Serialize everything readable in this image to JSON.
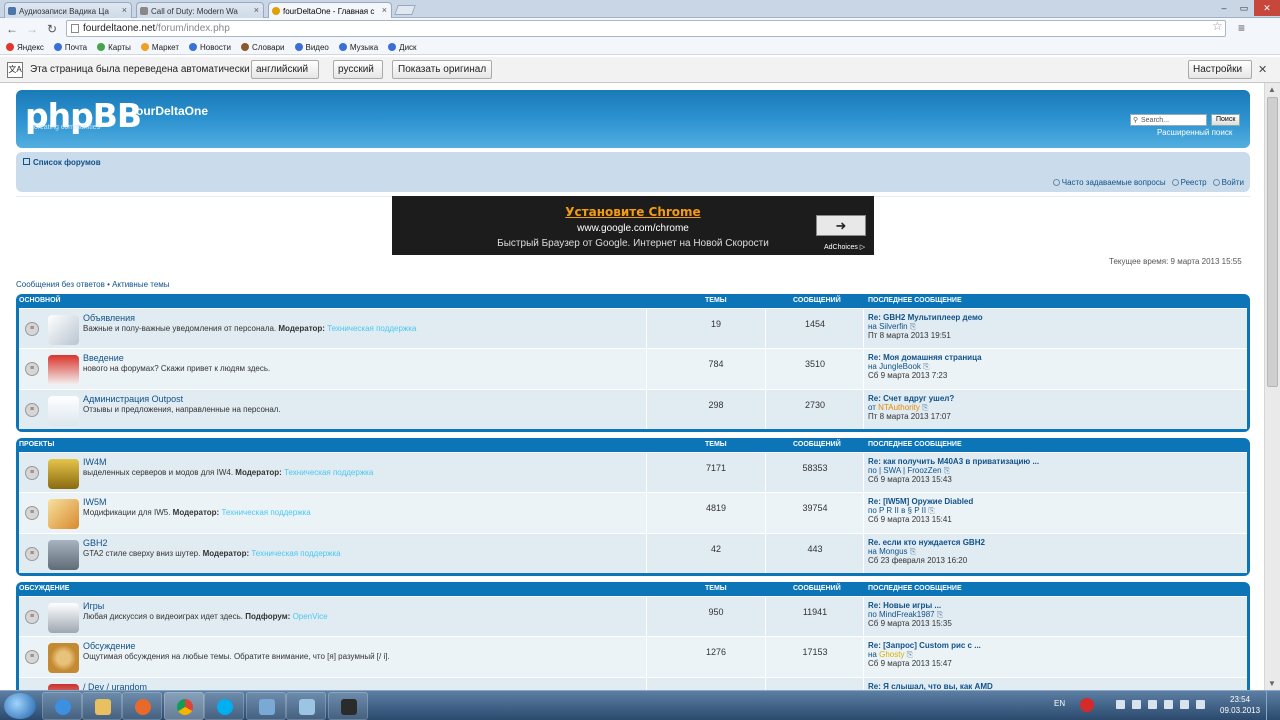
{
  "browser": {
    "tabs": [
      {
        "label": "Аудиозаписи Вадика Ца",
        "icon": "vk-icon",
        "color": "#4a76a8",
        "active": false
      },
      {
        "label": "Call of Duty: Modern Wa",
        "icon": "page-icon",
        "color": "#888888",
        "active": false
      },
      {
        "label": "fourDeltaOne - Главная с",
        "icon": "loading-icon",
        "color": "#e0a000",
        "active": true
      }
    ],
    "url_domain": "fourdeltaone.net",
    "url_path": "/forum/index.php",
    "bookmarks": [
      {
        "label": "Яндекс",
        "color": "#e0392b"
      },
      {
        "label": "Почта",
        "color": "#3a6fd8"
      },
      {
        "label": "Карты",
        "color": "#47a347"
      },
      {
        "label": "Маркет",
        "color": "#f0a020"
      },
      {
        "label": "Новости",
        "color": "#3a6fd8"
      },
      {
        "label": "Словари",
        "color": "#8a5a2b"
      },
      {
        "label": "Видео",
        "color": "#3a6fd8"
      },
      {
        "label": "Музыка",
        "color": "#3a6fd8"
      },
      {
        "label": "Диск",
        "color": "#3a6fd8"
      }
    ],
    "translate": {
      "message": "Эта страница была переведена автоматически",
      "from": "английский",
      "to": "русский",
      "show_original": "Показать оригинал",
      "settings": "Настройки"
    }
  },
  "forum": {
    "logo": "phpBB",
    "logo_sub": "creating communities",
    "site_name": "fourDeltaOne",
    "search_placeholder": "Search...",
    "search_button": "Поиск",
    "advanced_search": "Расширенный поиск",
    "breadcrumb": "Список форумов",
    "nav_links": [
      "Часто задаваемые вопросы",
      "Реестр",
      "Войти"
    ],
    "current_time": "Текущее время: 9 марта 2013 15:55",
    "quick_links": "Сообщения без ответов • Активные темы",
    "ad": {
      "title": "Установите Chrome",
      "url": "www.google.com/chrome",
      "description": "Быстрый Браузер от Google. Интернет на Новой Скорости",
      "choices": "AdChoices"
    },
    "col_topics": "ТЕМЫ",
    "col_posts": "СООБЩЕНИЙ",
    "col_last": "ПОСЛЕДНЕЕ СООБЩЕНИЕ",
    "categories": [
      {
        "name": "ОСНОВНОЙ",
        "forums": [
          {
            "title": "Объявления",
            "desc": "Важные и полу-важные уведомления от персонала.",
            "mod_label": "Модератор:",
            "mod": "Техническая поддержка",
            "topics": "19",
            "posts": "1454",
            "last_title": "Re: GBH2 Мультиплеер демо",
            "last_by": "на Silverfin",
            "last_date": "Пт 8 марта 2013 19:51",
            "icon": "megaphone-icon"
          },
          {
            "title": "Введение",
            "desc": "нового на форумах? Скажи привет к людям здесь.",
            "mod_label": "",
            "mod": "",
            "topics": "784",
            "posts": "3510",
            "last_title": "Re: Моя домашняя страница",
            "last_by": "на JungleBook",
            "last_date": "Сб 9 марта 2013 7:23",
            "icon": "house-icon"
          },
          {
            "title": "Администрация Outpost",
            "desc": "Отзывы и предложения, направленные на персонал.",
            "mod_label": "",
            "mod": "",
            "topics": "298",
            "posts": "2730",
            "last_title": "Re: Счет вдруг ушел?",
            "last_by": "от ",
            "last_by_user": "NTAuthority",
            "last_date": "Пт 8 марта 2013 17:07",
            "icon": "cloud-icon"
          }
        ]
      },
      {
        "name": "ПРОЕКТЫ",
        "forums": [
          {
            "title": "IW4M",
            "desc": "выделенных серверов и модов для IW4.",
            "mod_label": "Модератор:",
            "mod": "Техническая поддержка",
            "topics": "7171",
            "posts": "58353",
            "last_title": "Re: как получить M40A3 в приватизацию ...",
            "last_by": "по | SWA | FroozZen",
            "last_date": "Сб 9 марта 2013 15:43",
            "icon": "mw2-icon"
          },
          {
            "title": "IW5M",
            "desc": "Модификации для IW5.",
            "mod_label": "Модератор:",
            "mod": "Техническая поддержка",
            "topics": "4819",
            "posts": "39754",
            "last_title": "Re: [IW5M] Оружие Diabled",
            "last_by": "по P R II в § P II",
            "last_date": "Сб 9 марта 2013 15:41",
            "icon": "pencil-icon"
          },
          {
            "title": "GBH2",
            "desc": "GTA2 стиле сверху вниз шутер.",
            "mod_label": "Модератор:",
            "mod": "Техническая поддержка",
            "topics": "42",
            "posts": "443",
            "last_title": "Re. если кто нуждается GBH2",
            "last_by": "на Mongus",
            "last_date": "Сб 23 февраля 2013 16:20",
            "icon": "buildings-icon"
          }
        ]
      },
      {
        "name": "ОБСУЖДЕНИЕ",
        "forums": [
          {
            "title": "Игры",
            "desc": "Любая дискуссия о видеоиграх идет здесь.",
            "mod_label": "Подфорум:",
            "mod": "OpenVice",
            "topics": "950",
            "posts": "11941",
            "last_title": "Re: Новые игры ...",
            "last_by": "по MindFreak1987",
            "last_date": "Сб 9 марта 2013 15:35",
            "icon": "gamepad-icon"
          },
          {
            "title": "Обсуждение",
            "desc": "Ощутимая обсуждения на любые темы. Обратите внимание, что [я] разумный [/ i].",
            "mod_label": "",
            "mod": "",
            "topics": "1276",
            "posts": "17153",
            "last_title": "Re: [Запрос] Custom рис с ...",
            "last_by": "на ",
            "last_by_user": "Ghosty",
            "last_date": "Сб 9 марта 2013 15:47",
            "icon": "donut-icon"
          },
          {
            "title": "/ Dev / urandom",
            "desc": "",
            "mod_label": "",
            "mod": "",
            "topics": "",
            "posts": "",
            "last_title": "Re: Я слышал, что вы, как AMD",
            "last_by": "",
            "last_date": "",
            "icon": "random-icon"
          }
        ]
      }
    ]
  },
  "taskbar": {
    "lang": "EN",
    "time": "23:54",
    "date": "09.03.2013"
  }
}
